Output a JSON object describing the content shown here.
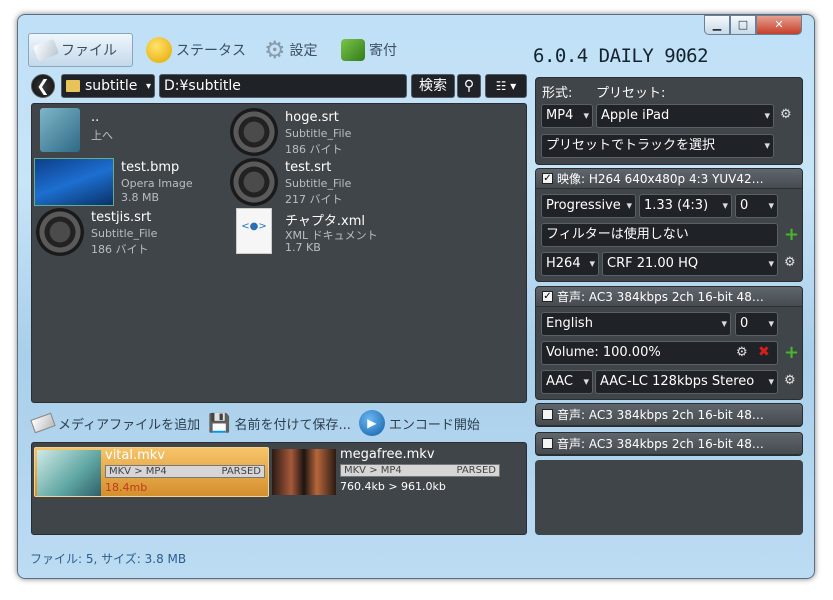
{
  "titlebar": {
    "minimize": "▁",
    "maximize": "□",
    "close": "✕"
  },
  "nav": {
    "file": "ファイル",
    "status": "ステータス",
    "settings": "設定",
    "donate": "寄付"
  },
  "version": "6.0.4 DAILY 9062",
  "pathbar": {
    "back": "❮",
    "folder": "subtitle",
    "path": "D:¥subtitle",
    "search": "検索",
    "search_icon": "⚲",
    "view": "☷ ▾"
  },
  "files": [
    {
      "name": "..",
      "desc": "上へ",
      "size": "",
      "icon": "folder-up-icon"
    },
    {
      "name": "hoge.srt",
      "desc": "Subtitle_File",
      "size": "186 バイト",
      "icon": "film-reel-icon"
    },
    {
      "name": "test.bmp",
      "desc": "Opera Image",
      "size": "3.8 MB",
      "icon": "image-thumbnail"
    },
    {
      "name": "test.srt",
      "desc": "Subtitle_File",
      "size": "217 バイト",
      "icon": "film-reel-icon"
    },
    {
      "name": "testjis.srt",
      "desc": "Subtitle_File",
      "size": "186 バイト",
      "icon": "film-reel-icon"
    },
    {
      "name": "チャプタ.xml",
      "desc": "XML ドキュメント",
      "size": "1.7 KB",
      "icon": "xml-file-icon"
    }
  ],
  "actions": {
    "add_media": "メディアファイルを追加",
    "save_as": "名前を付けて保存...",
    "encode": "エンコード開始"
  },
  "queue": [
    {
      "name": "vital.mkv",
      "conversion": "MKV > MP4",
      "state": "PARSED",
      "size": "18.4mb"
    },
    {
      "name": "megafree.mkv",
      "conversion": "MKV > MP4",
      "state": "PARSED",
      "size": "760.4kb > 961.0kb"
    }
  ],
  "footer": "ファイル: 5, サイズ: 3.8 MB",
  "format_panel": {
    "format_label": "形式:",
    "preset_label": "プリセット:",
    "format": "MP4",
    "preset": "Apple iPad",
    "track_preset": "プリセットでトラックを選択"
  },
  "video_panel": {
    "header": "映像: H264 640x480p 4:3 YUV42…",
    "scan": "Progressive",
    "aspect": "1.33 (4:3)",
    "index": "0",
    "filter": "フィルターは使用しない",
    "codec": "H264",
    "quality": "CRF 21.00 HQ"
  },
  "audio_panel": {
    "header": "音声: AC3 384kbps 2ch 16-bit 48…",
    "language": "English",
    "index": "0",
    "volume": "Volume: 100.00%",
    "codec": "AAC",
    "quality": "AAC-LC 128kbps Stereo"
  },
  "audio_tracks": [
    {
      "header": "音声: AC3 384kbps 2ch 16-bit 48…"
    },
    {
      "header": "音声: AC3 384kbps 2ch 16-bit 48…"
    }
  ],
  "colors": {
    "accent": "#46b72b",
    "selected_queue": "#f2b14a",
    "panel": "#40454a"
  }
}
